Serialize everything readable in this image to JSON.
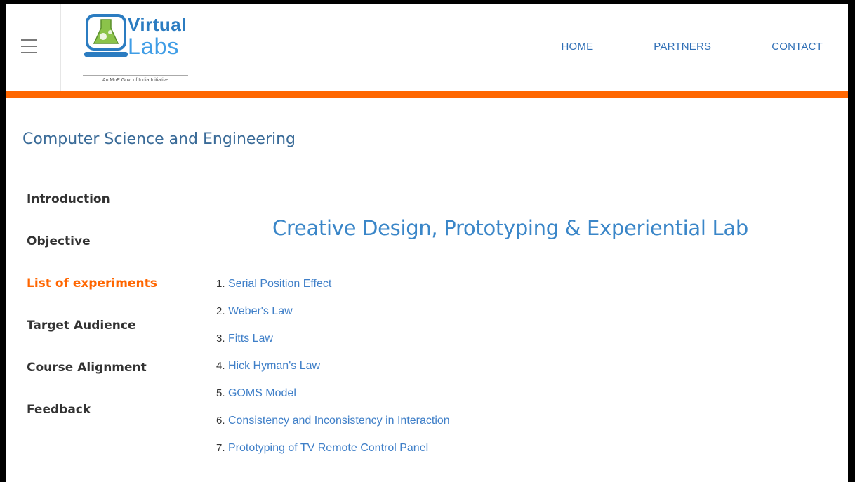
{
  "header": {
    "logo": {
      "text_top": "Virtual",
      "text_bottom": "Labs",
      "tagline": "An MoE Govt of India Initiative"
    },
    "nav": [
      {
        "label": "HOME"
      },
      {
        "label": "PARTNERS"
      },
      {
        "label": "CONTACT"
      }
    ]
  },
  "colors": {
    "accent_bar": "#ff6600",
    "link": "#3f7fc8",
    "title": "#3a86c8",
    "active_sidebar": "#ff6600"
  },
  "department": "Computer Science and Engineering",
  "sidebar": {
    "items": [
      {
        "label": "Introduction",
        "active": false
      },
      {
        "label": "Objective",
        "active": false
      },
      {
        "label": "List of experiments",
        "active": true
      },
      {
        "label": "Target Audience",
        "active": false
      },
      {
        "label": "Course Alignment",
        "active": false
      },
      {
        "label": "Feedback",
        "active": false
      }
    ]
  },
  "main": {
    "title": "Creative Design, Prototyping & Experiential Lab",
    "experiments": [
      {
        "num": "1.",
        "label": "Serial Position Effect"
      },
      {
        "num": "2.",
        "label": "Weber's Law"
      },
      {
        "num": "3.",
        "label": "Fitts Law"
      },
      {
        "num": "4.",
        "label": "Hick Hyman's Law"
      },
      {
        "num": "5.",
        "label": "GOMS Model"
      },
      {
        "num": "6.",
        "label": "Consistency and Inconsistency in Interaction"
      },
      {
        "num": "7.",
        "label": "Prototyping of TV Remote Control Panel"
      }
    ]
  }
}
